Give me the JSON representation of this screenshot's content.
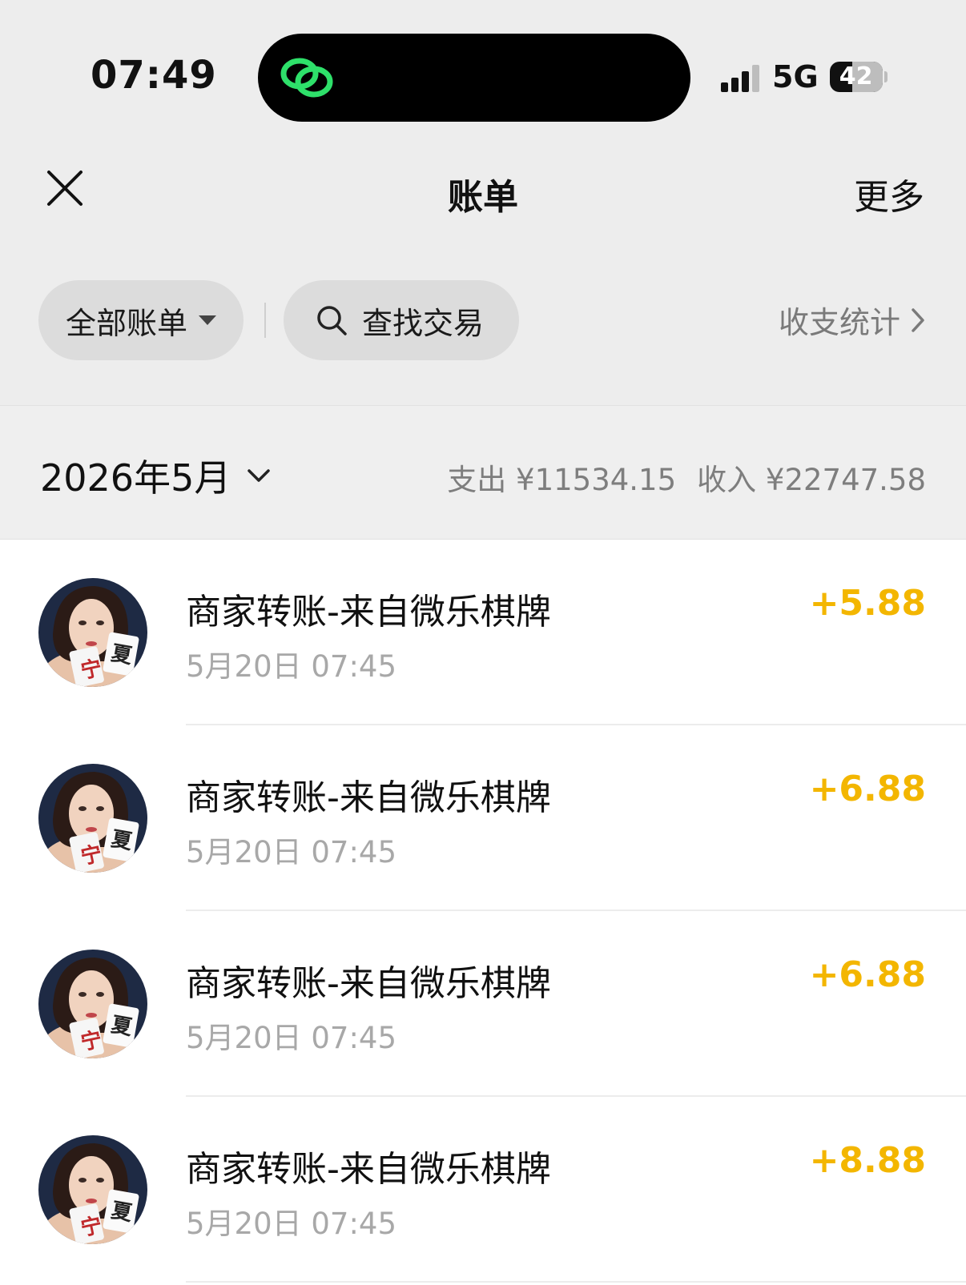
{
  "status_bar": {
    "time": "07:49",
    "network": "5G",
    "battery": "42",
    "battery_level": 0.42
  },
  "nav": {
    "title": "账单",
    "more": "更多"
  },
  "filters": {
    "all_bills": "全部账单",
    "search": "查找交易",
    "stats": "收支统计"
  },
  "month": {
    "label": "2026年5月",
    "expense": "支出 ¥11534.15",
    "income": "收入 ¥22747.58"
  },
  "transactions": [
    {
      "title": "商家转账-来自微乐棋牌",
      "time": "5月20日 07:45",
      "amount": "+5.88"
    },
    {
      "title": "商家转账-来自微乐棋牌",
      "time": "5月20日 07:45",
      "amount": "+6.88"
    },
    {
      "title": "商家转账-来自微乐棋牌",
      "time": "5月20日 07:45",
      "amount": "+6.88"
    },
    {
      "title": "商家转账-来自微乐棋牌",
      "time": "5月20日 07:45",
      "amount": "+8.88"
    }
  ],
  "colors": {
    "income_amount": "#f3b600",
    "island_logo": "#2ee06a"
  }
}
